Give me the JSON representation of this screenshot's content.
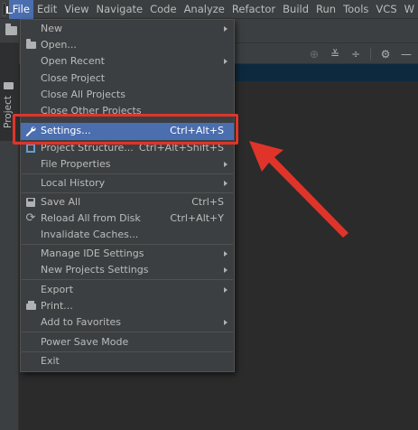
{
  "menubar": {
    "items": [
      "File",
      "Edit",
      "View",
      "Navigate",
      "Code",
      "Analyze",
      "Refactor",
      "Build",
      "Run",
      "Tools",
      "VCS",
      "W"
    ],
    "active": "File"
  },
  "left_strip": {
    "project_tab_label": "Project"
  },
  "panel_actions": {
    "icons": [
      "locate-icon",
      "collapse-all-icon",
      "expand-all-icon",
      "gear-icon",
      "minimize-icon"
    ]
  },
  "file_menu": {
    "items": [
      {
        "label": "New",
        "shortcut": "",
        "submenu": true,
        "icon": ""
      },
      {
        "label": "Open...",
        "shortcut": "",
        "submenu": false,
        "icon": "folder-open-icon"
      },
      {
        "label": "Open Recent",
        "shortcut": "",
        "submenu": true,
        "icon": ""
      },
      {
        "label": "Close Project",
        "shortcut": "",
        "submenu": false,
        "icon": ""
      },
      {
        "label": "Close All Projects",
        "shortcut": "",
        "submenu": false,
        "icon": ""
      },
      {
        "label": "Close Other Projects",
        "shortcut": "",
        "submenu": false,
        "icon": ""
      },
      {
        "label": "Settings...",
        "shortcut": "Ctrl+Alt+S",
        "submenu": false,
        "icon": "wrench-icon",
        "highlighted": true
      },
      {
        "label": "Project Structure...",
        "shortcut": "Ctrl+Alt+Shift+S",
        "submenu": false,
        "icon": "project-structure-icon"
      },
      {
        "label": "File Properties",
        "shortcut": "",
        "submenu": true,
        "icon": ""
      },
      {
        "label": "Local History",
        "shortcut": "",
        "submenu": true,
        "icon": ""
      },
      {
        "label": "Save All",
        "shortcut": "Ctrl+S",
        "submenu": false,
        "icon": "save-icon"
      },
      {
        "label": "Reload All from Disk",
        "shortcut": "Ctrl+Alt+Y",
        "submenu": false,
        "icon": "reload-icon"
      },
      {
        "label": "Invalidate Caches...",
        "shortcut": "",
        "submenu": false,
        "icon": ""
      },
      {
        "label": "Manage IDE Settings",
        "shortcut": "",
        "submenu": true,
        "icon": ""
      },
      {
        "label": "New Projects Settings",
        "shortcut": "",
        "submenu": true,
        "icon": ""
      },
      {
        "label": "Export",
        "shortcut": "",
        "submenu": true,
        "icon": ""
      },
      {
        "label": "Print...",
        "shortcut": "",
        "submenu": false,
        "icon": "print-icon"
      },
      {
        "label": "Add to Favorites",
        "shortcut": "",
        "submenu": true,
        "icon": ""
      },
      {
        "label": "Power Save Mode",
        "shortcut": "",
        "submenu": false,
        "icon": ""
      },
      {
        "label": "Exit",
        "shortcut": "",
        "submenu": false,
        "icon": ""
      }
    ]
  },
  "colors": {
    "menu_background": "#3c3f41",
    "highlight": "#4b6eaf",
    "annotation_red": "#e0342a",
    "editor_background": "#2b2b2b"
  }
}
